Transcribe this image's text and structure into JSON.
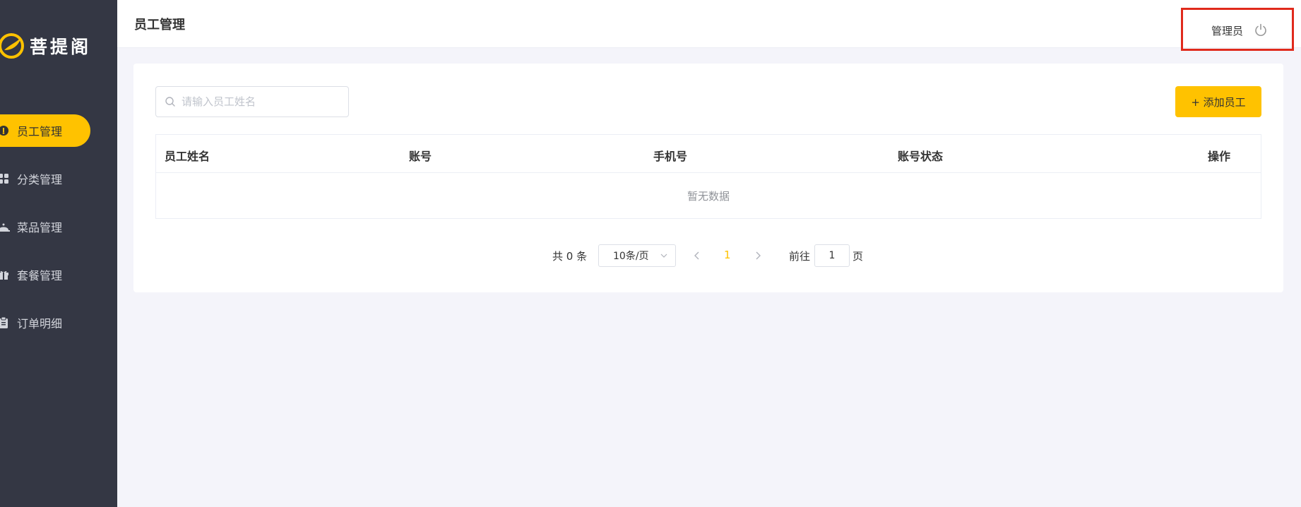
{
  "brand": {
    "name": "菩提阁"
  },
  "sidebar": {
    "items": [
      {
        "label": "员工管理",
        "icon": "user-icon",
        "active": true
      },
      {
        "label": "分类管理",
        "icon": "grid-icon",
        "active": false
      },
      {
        "label": "菜品管理",
        "icon": "dish-icon",
        "active": false
      },
      {
        "label": "套餐管理",
        "icon": "gift-icon",
        "active": false
      },
      {
        "label": "订单明细",
        "icon": "clipboard-icon",
        "active": false
      }
    ]
  },
  "header": {
    "title": "员工管理",
    "user_name": "管理员",
    "logout_icon": "power-icon"
  },
  "toolbar": {
    "search_placeholder": "请输入员工姓名",
    "add_button": "+ 添加员工"
  },
  "table": {
    "columns": [
      "员工姓名",
      "账号",
      "手机号",
      "账号状态",
      "操作"
    ],
    "rows": [],
    "empty_text": "暂无数据"
  },
  "pagination": {
    "total_text": "共 0 条",
    "page_size": "10条/页",
    "current_page": "1",
    "goto_label": "前往",
    "goto_value": "1",
    "page_suffix": "页"
  },
  "colors": {
    "accent": "#ffc200",
    "sidebar_bg": "#343744",
    "highlight_box": "#e02a1c"
  }
}
